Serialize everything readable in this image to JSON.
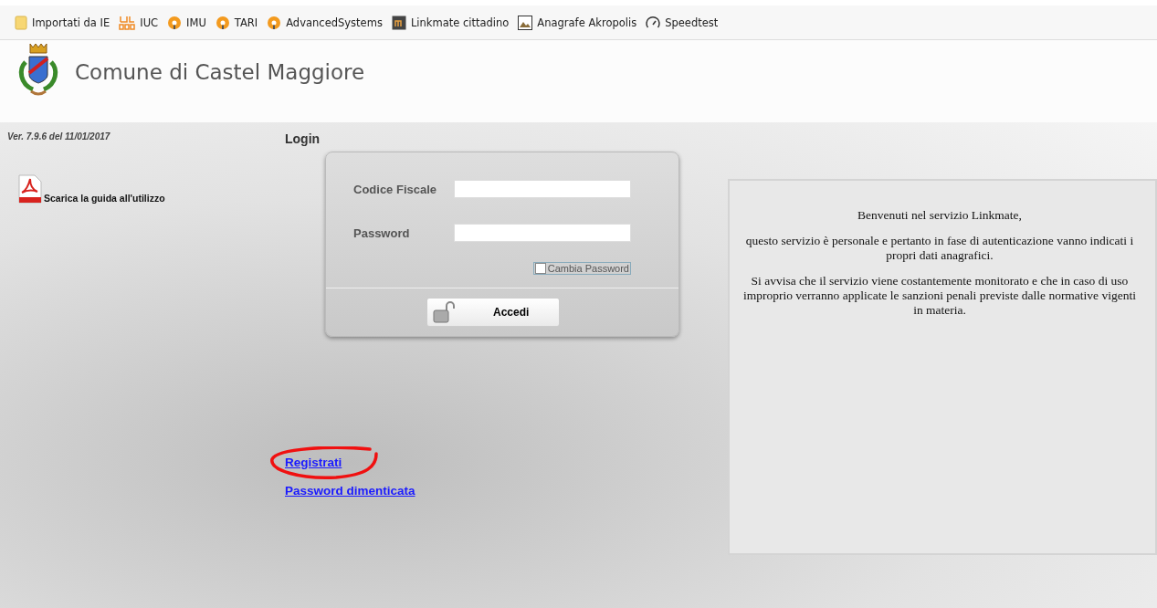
{
  "bookmarks": [
    {
      "label": "Importati da IE",
      "kind": "folder"
    },
    {
      "label": "IUC",
      "kind": "grid"
    },
    {
      "label": "IMU",
      "kind": "orange"
    },
    {
      "label": "TARI",
      "kind": "orange"
    },
    {
      "label": "AdvancedSystems",
      "kind": "orange"
    },
    {
      "label": "Linkmate cittadino",
      "kind": "square"
    },
    {
      "label": "Anagrafe Akropolis",
      "kind": "picture"
    },
    {
      "label": "Speedtest",
      "kind": "gauge"
    }
  ],
  "header": {
    "title": "Comune di Castel Maggiore"
  },
  "version": "Ver. 7.9.6 del 11/01/2017",
  "guide_link": "Scarica la guida all'utilizzo",
  "login": {
    "title": "Login",
    "fields": [
      {
        "label": "Codice Fiscale"
      },
      {
        "label": "Password"
      }
    ],
    "change_password": {
      "label": "Cambia Password",
      "checked": false
    },
    "submit": "Accedi"
  },
  "links": [
    "Registrati",
    "Password dimenticata"
  ],
  "info_panel": {
    "paragraphs": [
      "Benvenuti nel servizio Linkmate,",
      "questo servizio è personale e pertanto in fase di autenticazione vanno indicati i propri dati anagrafici.",
      "Si avvisa che il servizio viene costantemente monitorato e che in caso di uso improprio verranno applicate le sanzioni penali previste dalle normative vigenti in materia."
    ]
  }
}
